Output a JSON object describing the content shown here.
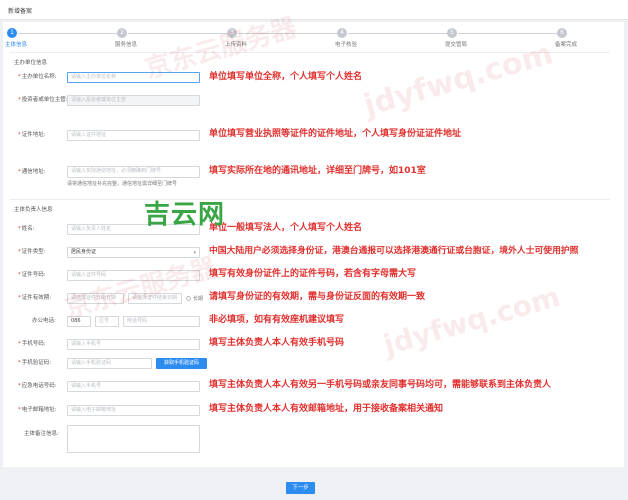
{
  "page_title": "新增备案",
  "steps": [
    {
      "num": "1",
      "label": "主体信息",
      "active": true
    },
    {
      "num": "2",
      "label": "服务信息",
      "active": false
    },
    {
      "num": "3",
      "label": "上传资料",
      "active": false
    },
    {
      "num": "4",
      "label": "电子核验",
      "active": false
    },
    {
      "num": "5",
      "label": "提交管局",
      "active": false
    },
    {
      "num": "6",
      "label": "备案完成",
      "active": false
    }
  ],
  "sponsor": {
    "section_title": "主办单位信息",
    "name_label": "主办单位名称:",
    "name_placeholder": "请输入主办单位名称",
    "gov_label": "投资者或单位主管:",
    "gov_placeholder": "请输入投资者或单位主管",
    "cert_addr_label": "证件地址:",
    "cert_addr_placeholder": "请输入证件地址",
    "mail_addr_label": "通信地址:",
    "mail_addr_placeholder": "请输入实际通信地址，必须精确到门牌号",
    "mail_addr_hint": "请将通信地址补充完整，通信地址需详细至门牌号"
  },
  "owner": {
    "section_title": "主体负责人信息",
    "name_label": "姓名:",
    "name_placeholder": "请输入负责人姓名",
    "cert_type_label": "证件类型:",
    "cert_type_value": "居民身份证",
    "cert_no_label": "证件号码:",
    "cert_no_placeholder": "请输入证件号码",
    "validity_label": "证件有效期:",
    "validity_start": "请选择证件开始日期",
    "validity_end": "请选择证件结束日期",
    "validity_long": "长期",
    "office_phone_label": "办公电话:",
    "phone_area": "086",
    "phone_code": "区号",
    "phone_number": "电话号码",
    "mobile_label": "手机号码:",
    "mobile_placeholder": "请输入手机号",
    "code_label": "手机验证码:",
    "code_placeholder": "请输入手机验证码",
    "code_button": "获取手机验证码",
    "emergency_label": "应急电话号码:",
    "emergency_placeholder": "请输入手机号",
    "email_label": "电子邮箱地址:",
    "email_placeholder": "请输入电子邮箱地址",
    "remark_label": "主体备注信息:"
  },
  "notes": {
    "n1": "单位填写单位全称，个人填写个人姓名",
    "n2": "单位填写营业执照等证件的证件地址，个人填写身份证证件地址",
    "n3": "填写实际所在地的通讯地址，详细至门牌号，如101室",
    "n4": "单位一般填写法人，个人填写个人姓名",
    "n5": "中国大陆用户必须选择身份证，港澳台通报可以选择港澳通行证或台胞证，境外人士可使用护照",
    "n6": "填写有效身份证件上的证件号码，若含有字母需大写",
    "n7": "请填写身份证的有效期，需与身份证反面的有效期一致",
    "n8": "非必填项，如有有效座机建议填写",
    "n9": "填写主体负责人本人有效手机号码",
    "n10": "填写主体负责人本人有效另一手机号码或亲友同事号码均可，需能够联系到主体负责人",
    "n11": "填写主体负责人本人有效邮箱地址，用于接收备案相关通知"
  },
  "logo_text": "吉云网",
  "next_button": "下一步",
  "watermarks": {
    "w1": "京东云服务器",
    "w2": "jdyfwq.com"
  },
  "colors": {
    "primary": "#2d8cf0",
    "note_red": "#e0312f",
    "logo_green": "#3aa545"
  }
}
